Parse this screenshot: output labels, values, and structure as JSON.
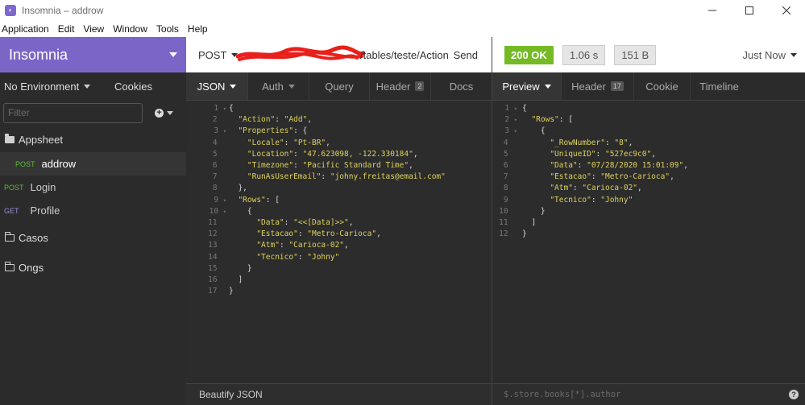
{
  "window": {
    "title": "Insomnia – addrow",
    "app_icon": "insomnia-logo-icon",
    "controls": [
      "minimize-icon",
      "maximize-icon",
      "close-icon"
    ]
  },
  "menu": [
    "Application",
    "Edit",
    "View",
    "Window",
    "Tools",
    "Help"
  ],
  "sidebar": {
    "workspace": "Insomnia",
    "environment": "No Environment",
    "cookies": "Cookies",
    "filter_placeholder": "Filter",
    "folders": [
      {
        "name": "Appsheet",
        "open": true,
        "items": [
          {
            "method": "POST",
            "name": "addrow",
            "active": true
          }
        ]
      }
    ],
    "items": [
      {
        "method": "POST",
        "name": "Login"
      },
      {
        "method": "GET",
        "name": "Profile"
      }
    ],
    "closed_folders": [
      "Casos",
      "Ongs"
    ],
    "colors": {
      "header": "#7a66c7",
      "post": "#5bbd36",
      "get": "#9b8ad6"
    }
  },
  "request": {
    "method": "POST",
    "url_visible": "/tables/teste/Action",
    "send_label": "Send",
    "tabs": [
      {
        "label": "JSON",
        "active": true,
        "dropdown": true
      },
      {
        "label": "Auth",
        "dropdown": true
      },
      {
        "label": "Query"
      },
      {
        "label": "Header",
        "badge": "2"
      },
      {
        "label": "Docs"
      }
    ],
    "body_lines": [
      "{",
      "  \"Action\": \"Add\",",
      "  \"Properties\": {",
      "    \"Locale\": \"Pt-BR\",",
      "    \"Location\": \"47.623098, -122.330184\",",
      "    \"Timezone\": \"Pacific Standard Time\",",
      "    \"RunAsUserEmail\": \"johny.freitas@email.com\"",
      "  },",
      "  \"Rows\": [",
      "    {",
      "      \"Data\": \"<<[Data]>>\",",
      "      \"Estacao\": \"Metro-Carioca\",",
      "      \"Atm\": \"Carioca-02\",",
      "      \"Tecnico\": \"Johny\"",
      "    }",
      "  ]",
      "}"
    ],
    "footer": "Beautify JSON"
  },
  "response": {
    "status": "200 OK",
    "time": "1.06 s",
    "size": "151 B",
    "when": "Just Now",
    "status_color": "#75ba24",
    "tabs": [
      {
        "label": "Preview",
        "active": true,
        "dropdown": true
      },
      {
        "label": "Header",
        "badge": "17"
      },
      {
        "label": "Cookie"
      },
      {
        "label": "Timeline"
      }
    ],
    "body_lines": [
      "{",
      "  \"Rows\": [",
      "    {",
      "      \"_RowNumber\": \"8\",",
      "      \"UniqueID\": \"527ec9c0\",",
      "      \"Data\": \"07/28/2020 15:01:09\",",
      "      \"Estacao\": \"Metro-Carioca\",",
      "      \"Atm\": \"Carioca-02\",",
      "      \"Tecnico\": \"Johny\"",
      "    }",
      "  ]",
      "}"
    ],
    "filter_placeholder": "$.store.books[*].author"
  }
}
